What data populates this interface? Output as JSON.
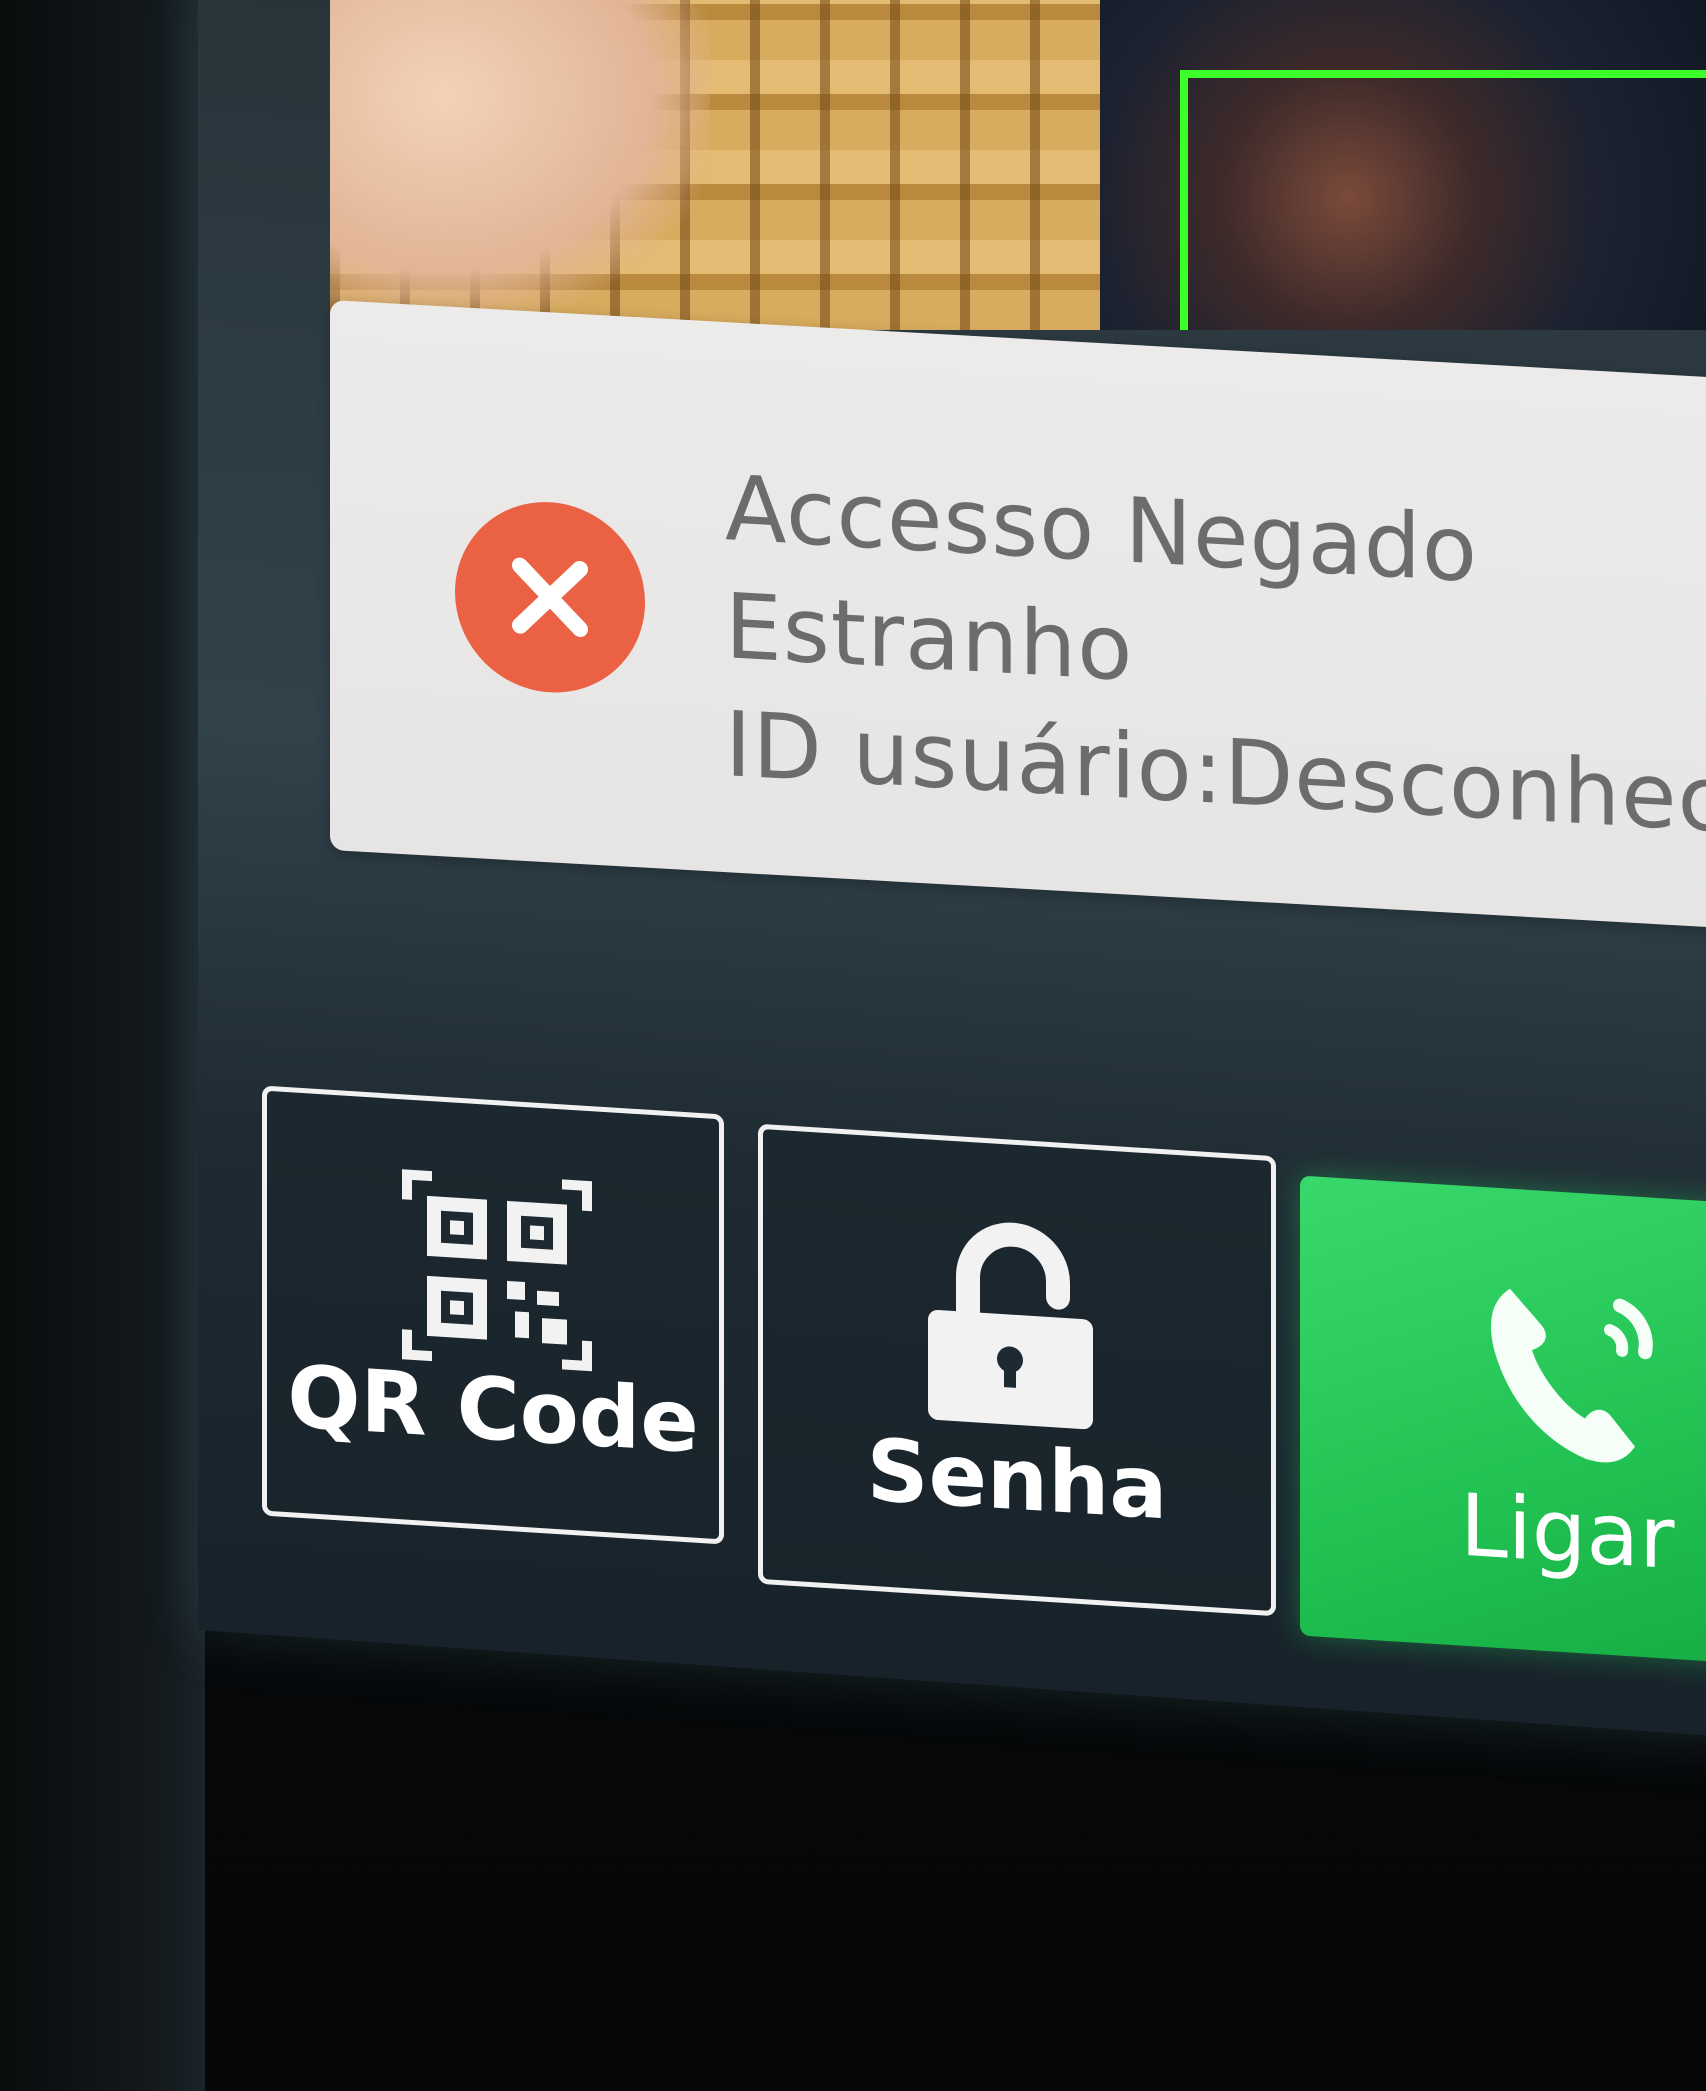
{
  "notification": {
    "status": "Accesso Negado",
    "person_type": "Estranho",
    "user_id_line": "ID usuário:Desconhecid",
    "icon": "close-icon",
    "icon_color": "#ea6243"
  },
  "actions": {
    "qr": {
      "label": "QR Code",
      "icon": "qr-code-icon"
    },
    "senha": {
      "label": "Senha",
      "icon": "unlock-icon"
    },
    "ligar": {
      "label": "Ligar",
      "icon": "phone-ringing-icon",
      "color": "#21c252"
    }
  },
  "camera": {
    "face_box_color": "#3cff2a"
  }
}
